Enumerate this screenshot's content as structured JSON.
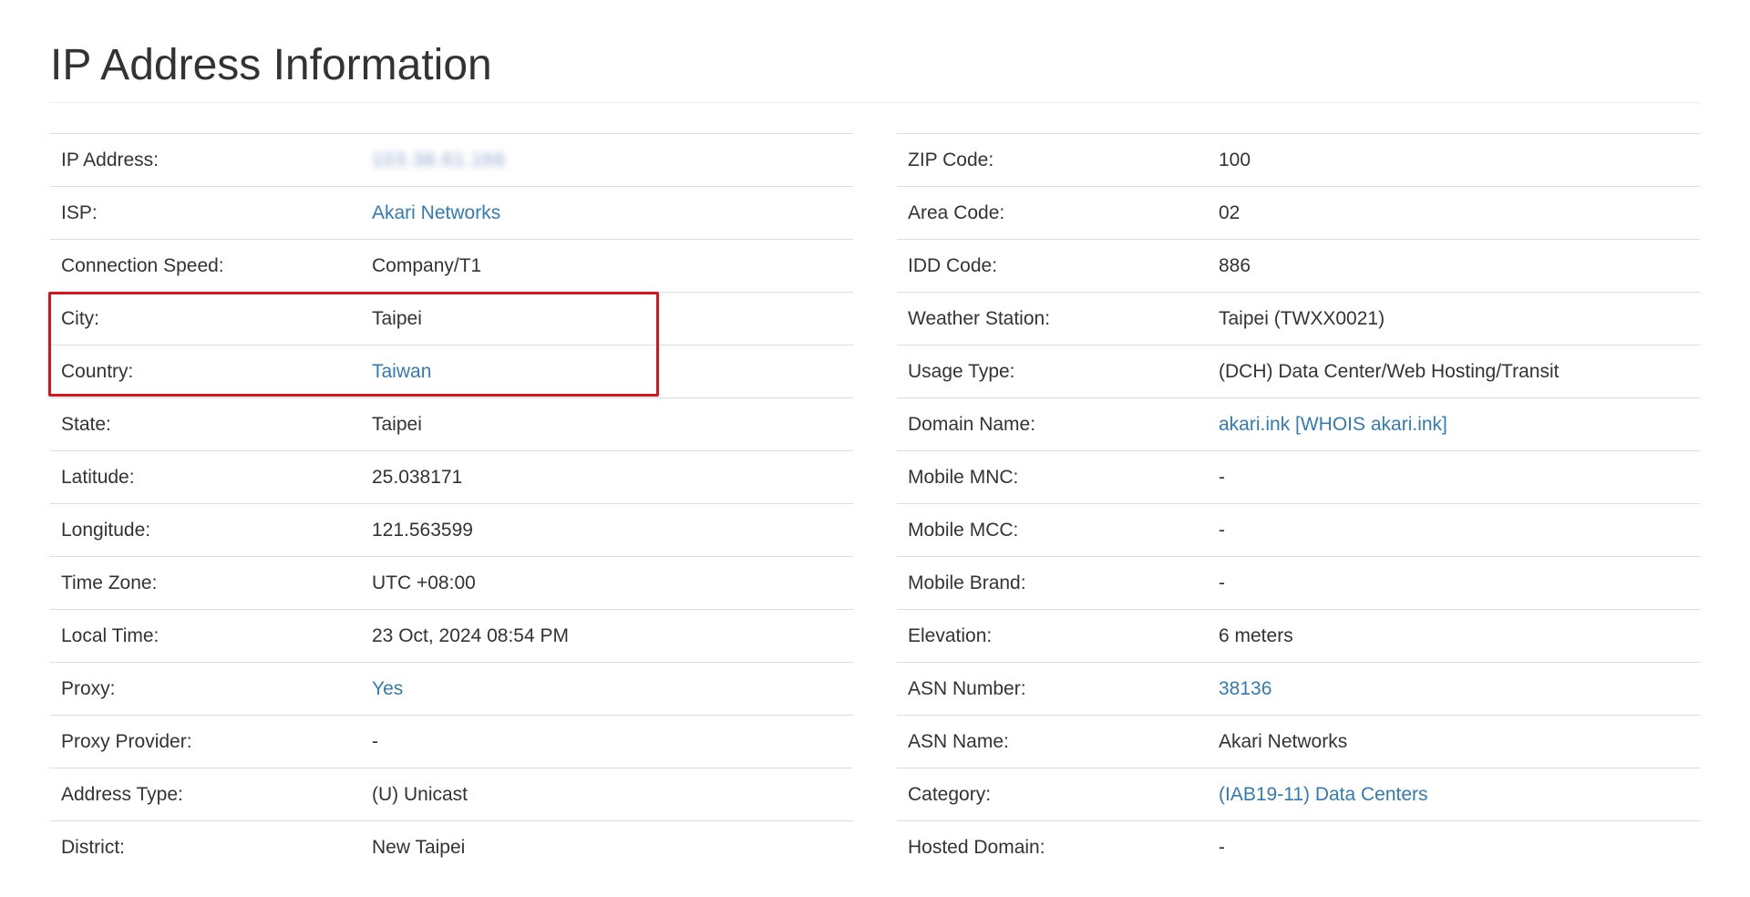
{
  "page": {
    "title": "IP Address Information"
  },
  "left": [
    {
      "label": "IP Address:",
      "value": "103.38.61.166",
      "style": "blurred"
    },
    {
      "label": "ISP:",
      "value": "Akari Networks",
      "style": "link"
    },
    {
      "label": "Connection Speed:",
      "value": "Company/T1",
      "style": "text"
    },
    {
      "label": "City:",
      "value": "Taipei",
      "style": "text"
    },
    {
      "label": "Country:",
      "value": "Taiwan",
      "style": "link"
    },
    {
      "label": "State:",
      "value": "Taipei",
      "style": "text"
    },
    {
      "label": "Latitude:",
      "value": "25.038171",
      "style": "text"
    },
    {
      "label": "Longitude:",
      "value": "121.563599",
      "style": "text"
    },
    {
      "label": "Time Zone:",
      "value": "UTC +08:00",
      "style": "text"
    },
    {
      "label": "Local Time:",
      "value": "23 Oct, 2024 08:54 PM",
      "style": "text"
    },
    {
      "label": "Proxy:",
      "value": "Yes",
      "style": "link"
    },
    {
      "label": "Proxy Provider:",
      "value": "-",
      "style": "text"
    },
    {
      "label": "Address Type:",
      "value": "(U) Unicast",
      "style": "text"
    },
    {
      "label": "District:",
      "value": "New Taipei",
      "style": "text"
    }
  ],
  "right": [
    {
      "label": "ZIP Code:",
      "value": "100",
      "style": "text"
    },
    {
      "label": "Area Code:",
      "value": "02",
      "style": "text"
    },
    {
      "label": "IDD Code:",
      "value": "886",
      "style": "text"
    },
    {
      "label": "Weather Station:",
      "value": "Taipei (TWXX0021)",
      "style": "text"
    },
    {
      "label": "Usage Type:",
      "value": "(DCH) Data Center/Web Hosting/Transit",
      "style": "text"
    },
    {
      "label": "Domain Name:",
      "value": "akari.ink [WHOIS akari.ink]",
      "style": "link"
    },
    {
      "label": "Mobile MNC:",
      "value": "-",
      "style": "text"
    },
    {
      "label": "Mobile MCC:",
      "value": "-",
      "style": "text"
    },
    {
      "label": "Mobile Brand:",
      "value": "-",
      "style": "text"
    },
    {
      "label": "Elevation:",
      "value": "6 meters",
      "style": "text"
    },
    {
      "label": "ASN Number:",
      "value": "38136",
      "style": "link"
    },
    {
      "label": "ASN Name:",
      "value": "Akari Networks",
      "style": "text"
    },
    {
      "label": "Category:",
      "value": "(IAB19-11) Data Centers",
      "style": "link"
    },
    {
      "label": "Hosted Domain:",
      "value": "-",
      "style": "text"
    }
  ],
  "colors": {
    "link": "#337ab7",
    "text": "#333333",
    "highlight": "#d9141b",
    "rule": "#dddddd"
  }
}
